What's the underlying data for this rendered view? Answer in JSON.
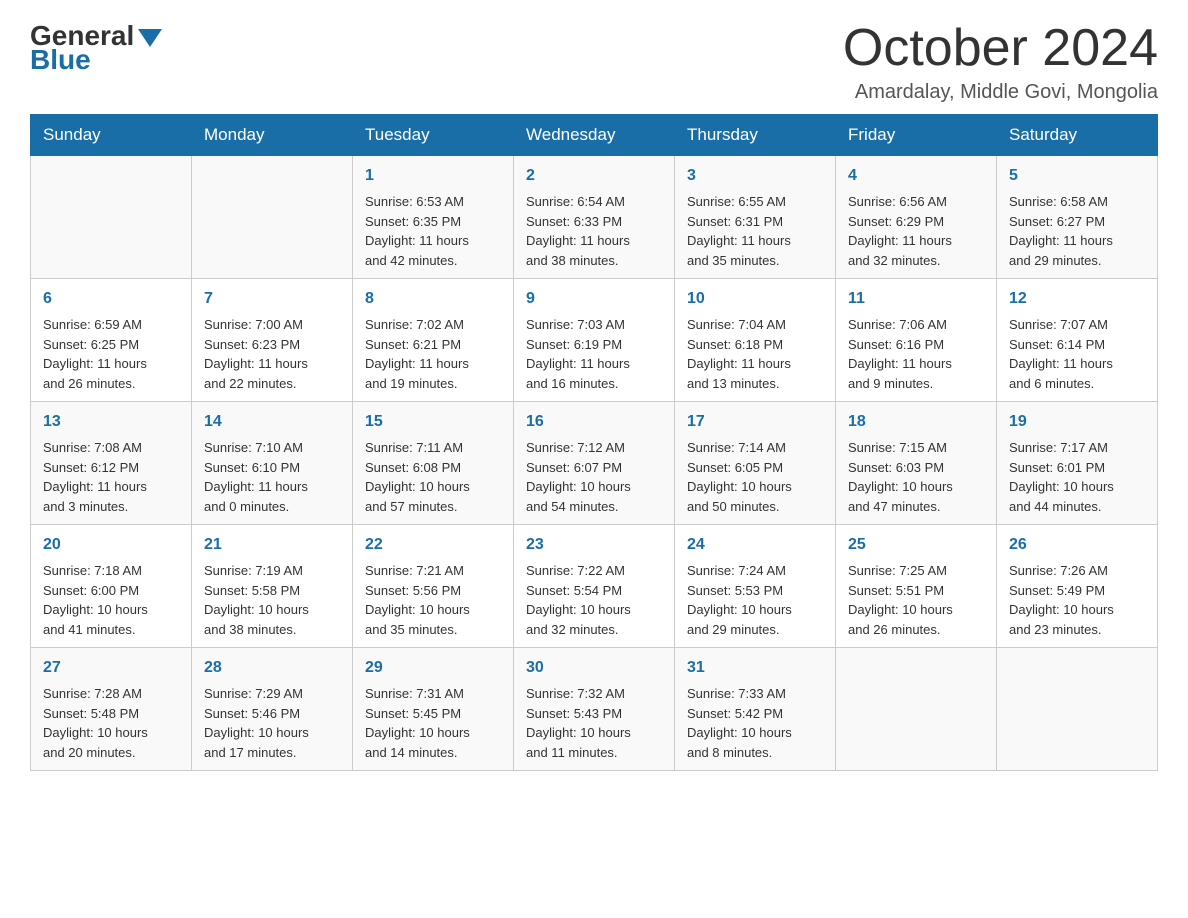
{
  "header": {
    "logo_general": "General",
    "logo_blue": "Blue",
    "month_title": "October 2024",
    "location": "Amardalay, Middle Govi, Mongolia"
  },
  "weekdays": [
    "Sunday",
    "Monday",
    "Tuesday",
    "Wednesday",
    "Thursday",
    "Friday",
    "Saturday"
  ],
  "weeks": [
    [
      {
        "day": "",
        "info": ""
      },
      {
        "day": "",
        "info": ""
      },
      {
        "day": "1",
        "info": "Sunrise: 6:53 AM\nSunset: 6:35 PM\nDaylight: 11 hours\nand 42 minutes."
      },
      {
        "day": "2",
        "info": "Sunrise: 6:54 AM\nSunset: 6:33 PM\nDaylight: 11 hours\nand 38 minutes."
      },
      {
        "day": "3",
        "info": "Sunrise: 6:55 AM\nSunset: 6:31 PM\nDaylight: 11 hours\nand 35 minutes."
      },
      {
        "day": "4",
        "info": "Sunrise: 6:56 AM\nSunset: 6:29 PM\nDaylight: 11 hours\nand 32 minutes."
      },
      {
        "day": "5",
        "info": "Sunrise: 6:58 AM\nSunset: 6:27 PM\nDaylight: 11 hours\nand 29 minutes."
      }
    ],
    [
      {
        "day": "6",
        "info": "Sunrise: 6:59 AM\nSunset: 6:25 PM\nDaylight: 11 hours\nand 26 minutes."
      },
      {
        "day": "7",
        "info": "Sunrise: 7:00 AM\nSunset: 6:23 PM\nDaylight: 11 hours\nand 22 minutes."
      },
      {
        "day": "8",
        "info": "Sunrise: 7:02 AM\nSunset: 6:21 PM\nDaylight: 11 hours\nand 19 minutes."
      },
      {
        "day": "9",
        "info": "Sunrise: 7:03 AM\nSunset: 6:19 PM\nDaylight: 11 hours\nand 16 minutes."
      },
      {
        "day": "10",
        "info": "Sunrise: 7:04 AM\nSunset: 6:18 PM\nDaylight: 11 hours\nand 13 minutes."
      },
      {
        "day": "11",
        "info": "Sunrise: 7:06 AM\nSunset: 6:16 PM\nDaylight: 11 hours\nand 9 minutes."
      },
      {
        "day": "12",
        "info": "Sunrise: 7:07 AM\nSunset: 6:14 PM\nDaylight: 11 hours\nand 6 minutes."
      }
    ],
    [
      {
        "day": "13",
        "info": "Sunrise: 7:08 AM\nSunset: 6:12 PM\nDaylight: 11 hours\nand 3 minutes."
      },
      {
        "day": "14",
        "info": "Sunrise: 7:10 AM\nSunset: 6:10 PM\nDaylight: 11 hours\nand 0 minutes."
      },
      {
        "day": "15",
        "info": "Sunrise: 7:11 AM\nSunset: 6:08 PM\nDaylight: 10 hours\nand 57 minutes."
      },
      {
        "day": "16",
        "info": "Sunrise: 7:12 AM\nSunset: 6:07 PM\nDaylight: 10 hours\nand 54 minutes."
      },
      {
        "day": "17",
        "info": "Sunrise: 7:14 AM\nSunset: 6:05 PM\nDaylight: 10 hours\nand 50 minutes."
      },
      {
        "day": "18",
        "info": "Sunrise: 7:15 AM\nSunset: 6:03 PM\nDaylight: 10 hours\nand 47 minutes."
      },
      {
        "day": "19",
        "info": "Sunrise: 7:17 AM\nSunset: 6:01 PM\nDaylight: 10 hours\nand 44 minutes."
      }
    ],
    [
      {
        "day": "20",
        "info": "Sunrise: 7:18 AM\nSunset: 6:00 PM\nDaylight: 10 hours\nand 41 minutes."
      },
      {
        "day": "21",
        "info": "Sunrise: 7:19 AM\nSunset: 5:58 PM\nDaylight: 10 hours\nand 38 minutes."
      },
      {
        "day": "22",
        "info": "Sunrise: 7:21 AM\nSunset: 5:56 PM\nDaylight: 10 hours\nand 35 minutes."
      },
      {
        "day": "23",
        "info": "Sunrise: 7:22 AM\nSunset: 5:54 PM\nDaylight: 10 hours\nand 32 minutes."
      },
      {
        "day": "24",
        "info": "Sunrise: 7:24 AM\nSunset: 5:53 PM\nDaylight: 10 hours\nand 29 minutes."
      },
      {
        "day": "25",
        "info": "Sunrise: 7:25 AM\nSunset: 5:51 PM\nDaylight: 10 hours\nand 26 minutes."
      },
      {
        "day": "26",
        "info": "Sunrise: 7:26 AM\nSunset: 5:49 PM\nDaylight: 10 hours\nand 23 minutes."
      }
    ],
    [
      {
        "day": "27",
        "info": "Sunrise: 7:28 AM\nSunset: 5:48 PM\nDaylight: 10 hours\nand 20 minutes."
      },
      {
        "day": "28",
        "info": "Sunrise: 7:29 AM\nSunset: 5:46 PM\nDaylight: 10 hours\nand 17 minutes."
      },
      {
        "day": "29",
        "info": "Sunrise: 7:31 AM\nSunset: 5:45 PM\nDaylight: 10 hours\nand 14 minutes."
      },
      {
        "day": "30",
        "info": "Sunrise: 7:32 AM\nSunset: 5:43 PM\nDaylight: 10 hours\nand 11 minutes."
      },
      {
        "day": "31",
        "info": "Sunrise: 7:33 AM\nSunset: 5:42 PM\nDaylight: 10 hours\nand 8 minutes."
      },
      {
        "day": "",
        "info": ""
      },
      {
        "day": "",
        "info": ""
      }
    ]
  ]
}
